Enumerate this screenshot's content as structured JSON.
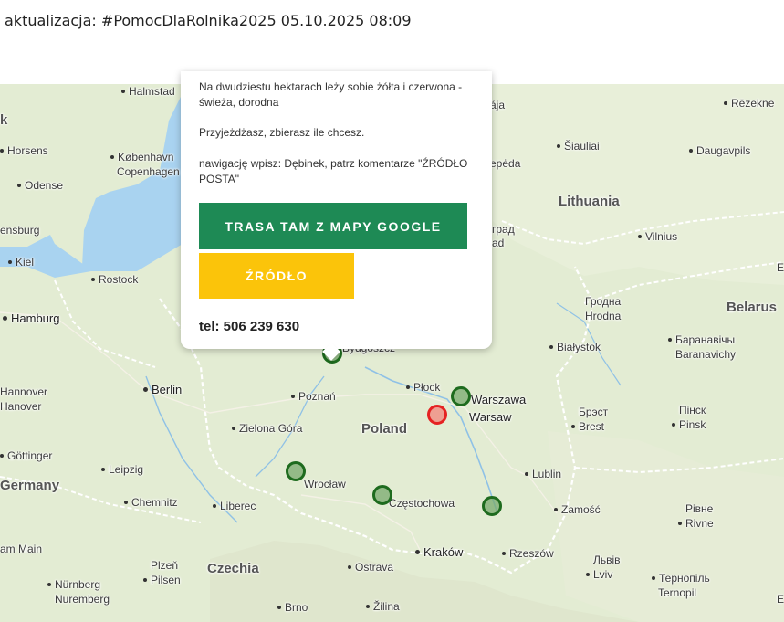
{
  "header": {
    "update_text": "aktualizacja: #PomocDlaRolnika2025 05.10.2025 08:09"
  },
  "popup": {
    "description_line1": "Na dwudziestu hektarach leży sobie żółta i czerwona - świeża, dorodna",
    "description_line2": "Przyjeżdżasz, zbierasz ile chcesz.",
    "description_line3": "nawigację wpisz: Dębinek, patrz komentarze \"ŹRÓDŁO POSTA\"",
    "route_button": "TRASA TAM Z MAPY GOOGLE",
    "source_button": "ŹRÓDŁO",
    "phone": "tel: 506 239 630"
  },
  "map": {
    "colors": {
      "land": "#e3ecd3",
      "water": "#a9d3f0",
      "marker_green": "#1e6b1e",
      "marker_red": "#e52222"
    },
    "labels": {
      "halmstad": "Halmstad",
      "k": "k",
      "horsens": "Horsens",
      "kobenhavn": "København",
      "copenhagen": "Copenhagen",
      "odense": "Odense",
      "ensburg": "ensburg",
      "kiel": "Kiel",
      "rostock": "Rostock",
      "hamburg": "Hamburg",
      "hannover1": "Hannover",
      "hannover2": "Hanover",
      "berlin": "Berlin",
      "goettinger": "Göttinger",
      "germany": "Germany",
      "leipzig": "Leipzig",
      "chemnitz": "Chemnitz",
      "liberec": "Liberec",
      "main": "am Main",
      "plzen1": "Plzeň",
      "plzen2": "Pilsen",
      "nurnberg1": "Nürnberg",
      "nurnberg2": "Nuremberg",
      "czechia": "Czechia",
      "brno": "Brno",
      "ostrava": "Ostrava",
      "zilina": "Žilina",
      "krakow": "Kraków",
      "rzeszow": "Rzeszów",
      "czestochowa": "Częstochowa",
      "wroclaw": "Wrocław",
      "zielona": "Zielona Góra",
      "poznan": "Poznań",
      "poland": "Poland",
      "bydgoszcz": "Bydgoszcz",
      "plock": "Płock",
      "warszawa": "Warszawa",
      "warsaw": "Warsaw",
      "lublin": "Lublin",
      "zamosc": "Zamość",
      "bialystok": "Białystok",
      "grodno1": "Гродна",
      "grodno2": "Hrodna",
      "grad1": "град",
      "grad2": "ad",
      "vilnius": "Vilnius",
      "lithuania": "Lithuania",
      "siauliai": "Šiauliai",
      "daugavpils": "Daugavpils",
      "rezekne": "Rēzekne",
      "aja": "ája",
      "peda": "ерėda",
      "belarus": "Belarus",
      "baranovichi1": "Баранавічы",
      "baranovichi2": "Baranavichy",
      "brest1": "Брэст",
      "brest2": "Brest",
      "pinsk1": "Пінск",
      "pinsk2": "Pinsk",
      "rivne1": "Рівне",
      "rivne2": "Rivne",
      "lviv1": "Львів",
      "lviv2": "Lviv",
      "ternopil1": "Тернопіль",
      "ternopil2": "Ternopil",
      "e1": "E",
      "e2": "E"
    }
  }
}
